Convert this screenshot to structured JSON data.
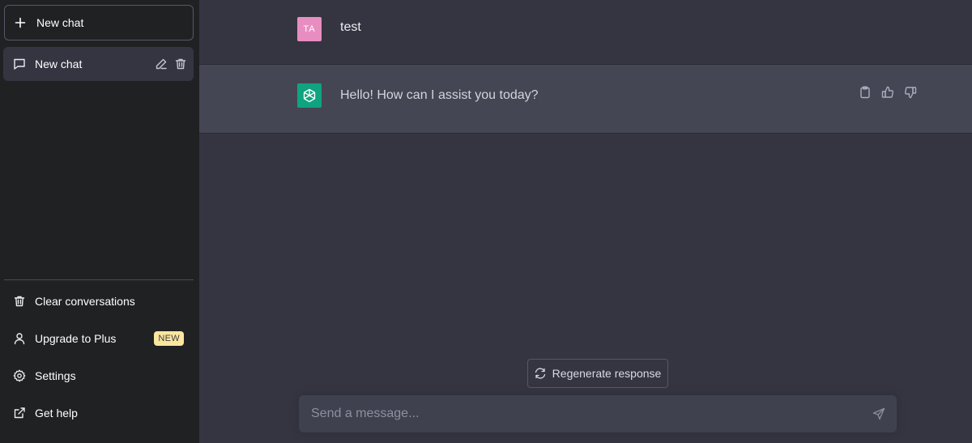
{
  "sidebar": {
    "new_chat_label": "New chat",
    "conversations": [
      {
        "label": "New chat"
      }
    ],
    "menu": {
      "clear_label": "Clear conversations",
      "upgrade_label": "Upgrade to Plus",
      "upgrade_badge": "NEW",
      "settings_label": "Settings",
      "help_label": "Get help"
    }
  },
  "conversation": {
    "user": {
      "avatar_initials": "TA",
      "message": "test"
    },
    "assistant": {
      "message": "Hello! How can I assist you today?"
    }
  },
  "composer": {
    "regenerate_label": "Regenerate response",
    "placeholder": "Send a message..."
  },
  "colors": {
    "sidebar_bg": "#202123",
    "main_bg": "#343541",
    "assistant_bg": "#444654",
    "brand_green": "#10a37f",
    "user_avatar": "#e88dc2",
    "badge_bg": "#fae69e"
  },
  "icons": [
    "plus-icon",
    "chat-bubble-icon",
    "edit-icon",
    "trash-icon",
    "user-icon",
    "gear-icon",
    "external-link-icon",
    "openai-logo-icon",
    "clipboard-icon",
    "thumbs-up-icon",
    "thumbs-down-icon",
    "refresh-icon",
    "send-icon"
  ]
}
